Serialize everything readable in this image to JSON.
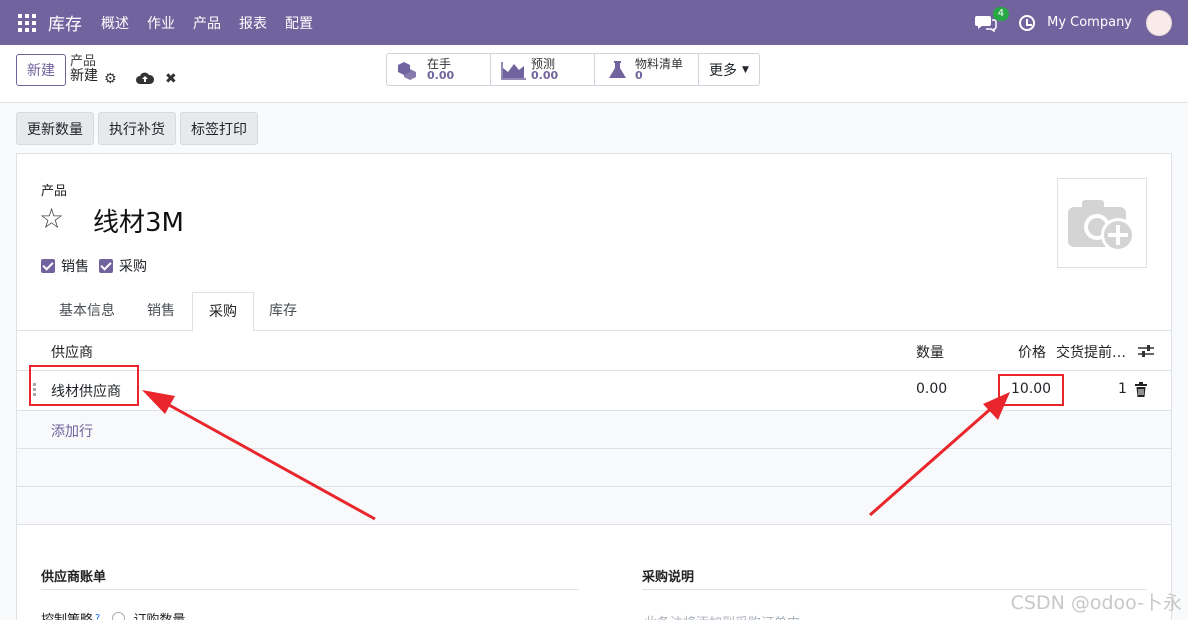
{
  "navbar": {
    "brand": "库存",
    "menu": [
      "概述",
      "作业",
      "产品",
      "报表",
      "配置"
    ],
    "chat_badge": "4",
    "company": "My Company"
  },
  "control_panel": {
    "new_label": "新建",
    "breadcrumb_parent": "产品",
    "breadcrumb_current": "新建",
    "stats": [
      {
        "label": "在手",
        "value": "0.00",
        "icon": "cubes-icon"
      },
      {
        "label": "预测",
        "value": "0.00",
        "icon": "area-chart-icon"
      },
      {
        "label": "物料清单",
        "value": "0",
        "icon": "flask-icon"
      }
    ],
    "more_label": "更多"
  },
  "actions": [
    "更新数量",
    "执行补货",
    "标签打印"
  ],
  "form": {
    "product_label": "产品",
    "product_name": "线材3M",
    "checkboxes": [
      {
        "label": "销售",
        "checked": true
      },
      {
        "label": "采购",
        "checked": true
      }
    ],
    "tabs": [
      "基本信息",
      "销售",
      "采购",
      "库存"
    ],
    "active_tab": "采购",
    "table": {
      "headers": {
        "vendor": "供应商",
        "qty": "数量",
        "price": "价格",
        "lead": "交货提前…"
      },
      "rows": [
        {
          "vendor": "线材供应商",
          "qty": "0.00",
          "price": "10.00",
          "lead": "1"
        }
      ],
      "add_line": "添加行"
    },
    "vendor_bills_title": "供应商账单",
    "control_policy_label": "控制策略",
    "control_policy_help": "?",
    "control_policy_option": "订购数量",
    "purchase_notes_title": "采购说明",
    "purchase_notes_placeholder": "此备注将添加到采购订单中。"
  },
  "colors": {
    "brand": "#71639e",
    "highlight": "#e8262c"
  },
  "watermark": "CSDN @odoo-卜永"
}
